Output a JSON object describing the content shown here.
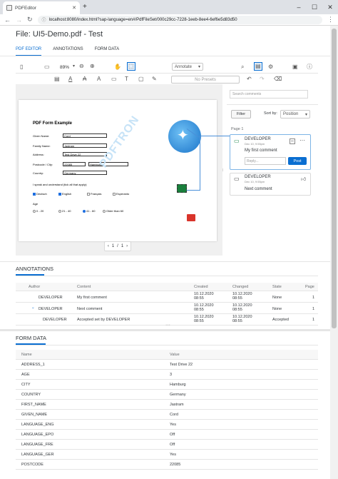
{
  "browser": {
    "tab_title": "PDFEditor",
    "new_tab": "+",
    "url": "localhost:8080/index.html?sap-language=en#/PdfFileSet/000c29cc-7228-1eeb-8ee4-6ef6e5d83d50"
  },
  "page": {
    "title": "File: UI5-Demo.pdf - Test"
  },
  "tabs": [
    "PDF EDITOR",
    "ANNOTATIONS",
    "FORM DATA"
  ],
  "toolbar": {
    "zoom": "89%",
    "mode": "Annotate",
    "presets": "No Presets"
  },
  "pdf": {
    "title": "PDF Form Example",
    "fields": [
      {
        "label": "Given Name:",
        "value": "Cord"
      },
      {
        "label": "Family Name:",
        "value": "Jastram"
      },
      {
        "label": "Address:",
        "value": "Test Drive 22"
      },
      {
        "label": "Postcode / City:",
        "value": "22085",
        "value2": "Hamburg"
      },
      {
        "label": "Country:",
        "value": "Germany"
      }
    ],
    "lang_q": "I speak and understand (tick all that apply):",
    "langs": [
      "Deutsch",
      "English",
      "Français",
      "Esperanto"
    ],
    "age_label": "Age",
    "ages": [
      "0 - 20",
      "21 - 40",
      "41 - 60",
      "Older than 60"
    ],
    "watermark": "PDFTRON",
    "pager": {
      "current": "1",
      "sep": "/",
      "total": "1",
      "prev": "‹",
      "next": "›"
    }
  },
  "comments": {
    "search_placeholder": "Search comments",
    "filter": "Filter",
    "sort_label": "Sort by:",
    "sort_value": "Position",
    "page_label": "Page 1",
    "items": [
      {
        "author": "DEVELOPER",
        "date": "Dec 10, 9:55pm",
        "text": "My first comment",
        "reply_placeholder": "Reply...",
        "post": "Post"
      },
      {
        "author": "DEVELOPER",
        "date": "Dec 10, 9:55pm",
        "text": "Next comment"
      }
    ]
  },
  "annotations": {
    "title": "ANNOTATIONS",
    "headers": [
      "Author",
      "Content",
      "Created",
      "Changed",
      "State",
      "Page"
    ],
    "rows": [
      {
        "author": "DEVELOPER",
        "content": "My first comment",
        "created": "10.12.2020 08:55",
        "changed": "10.12.2020 08:55",
        "state": "None",
        "page": "1"
      },
      {
        "author": "DEVELOPER",
        "content": "Next comment",
        "created": "10.12.2020 08:55",
        "changed": "10.12.2020 08:55",
        "state": "None",
        "page": "1"
      },
      {
        "author": "DEVELOPER",
        "content": "Accepted set by DEVELOPER",
        "created": "10.12.2020 08:55",
        "changed": "10.12.2020 08:55",
        "state": "Accepted",
        "page": "1"
      }
    ]
  },
  "form_data": {
    "title": "FORM DATA",
    "headers": [
      "Name",
      "Value"
    ],
    "rows": [
      {
        "name": "ADDRESS_1",
        "value": "Test Drive 22"
      },
      {
        "name": "AGE",
        "value": "3"
      },
      {
        "name": "CITY",
        "value": "Hamburg"
      },
      {
        "name": "COUNTRY",
        "value": "Germany"
      },
      {
        "name": "FIRST_NAME",
        "value": "Jastram"
      },
      {
        "name": "GIVEN_NAME",
        "value": "Cord"
      },
      {
        "name": "LANGUAGE_ENG",
        "value": "Yes"
      },
      {
        "name": "LANGUAGE_EPO",
        "value": "Off"
      },
      {
        "name": "LANGUAGE_FRE",
        "value": "Off"
      },
      {
        "name": "LANGUAGE_GER",
        "value": "Yes"
      },
      {
        "name": "POSTCODE",
        "value": "22085"
      }
    ]
  },
  "colors": {
    "accent": "#0a6ed1",
    "check": "#1e6fe0",
    "note_green": "#107e3e",
    "note_red": "#e34234"
  }
}
